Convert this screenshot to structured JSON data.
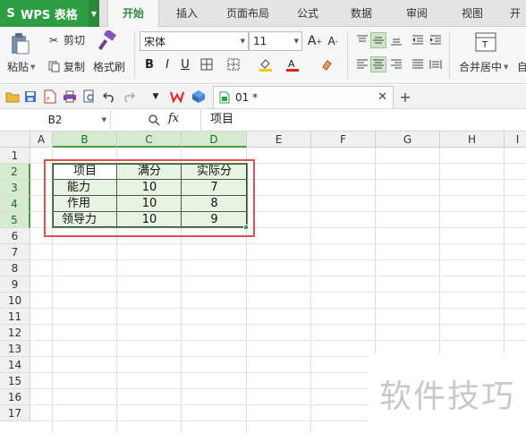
{
  "app": {
    "name": "WPS 表格",
    "logo_glyph": "S",
    "accent": "#2e9e42"
  },
  "tabs": [
    {
      "label": "开始",
      "active": true
    },
    {
      "label": "插入"
    },
    {
      "label": "页面布局"
    },
    {
      "label": "公式"
    },
    {
      "label": "数据"
    },
    {
      "label": "审阅"
    },
    {
      "label": "视图"
    },
    {
      "label": "开"
    }
  ],
  "ribbon": {
    "paste_label": "粘贴",
    "cut_label": "剪切",
    "copy_label": "复制",
    "format_painter_label": "格式刷",
    "font_name": "宋体",
    "font_size": "11",
    "bold": "B",
    "italic": "I",
    "underline": "U",
    "merge_label": "合并居中",
    "wrap_label": "自"
  },
  "document": {
    "tab_name": "01 *"
  },
  "formula_bar": {
    "name_box": "B2",
    "fx": "fx",
    "content": "项目"
  },
  "sheet": {
    "columns": [
      "A",
      "B",
      "C",
      "D",
      "E",
      "F",
      "G",
      "H",
      "I"
    ],
    "selected_columns": [
      "B",
      "C",
      "D"
    ],
    "rows": [
      "1",
      "2",
      "3",
      "4",
      "5",
      "6",
      "7",
      "8",
      "9",
      "10",
      "11",
      "12",
      "13",
      "14",
      "15",
      "16",
      "17"
    ],
    "selected_rows": [
      "2",
      "3",
      "4",
      "5"
    ],
    "table": [
      [
        "项目",
        "满分",
        "实际分"
      ],
      [
        "能力",
        "10",
        "7"
      ],
      [
        "作用",
        "10",
        "8"
      ],
      [
        "领导力",
        "10",
        "9"
      ]
    ]
  },
  "watermark": "软件技巧"
}
